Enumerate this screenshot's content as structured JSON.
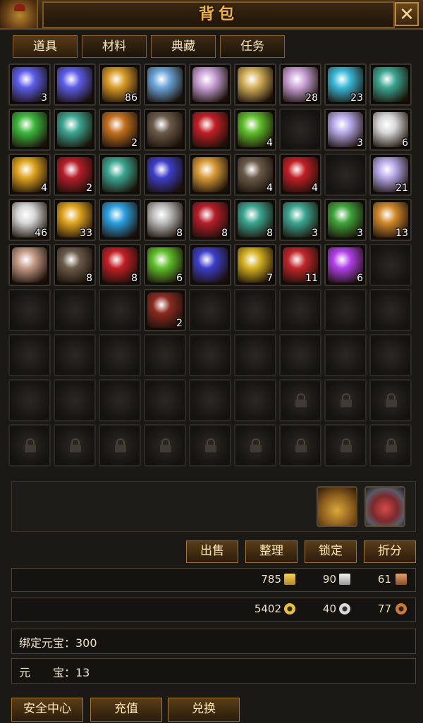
{
  "window": {
    "title": "背包",
    "close_label": "✕"
  },
  "tabs": [
    {
      "label": "道具"
    },
    {
      "label": "材料"
    },
    {
      "label": "典藏"
    },
    {
      "label": "任务"
    }
  ],
  "slots": [
    {
      "icon": "crystal-ball-icon",
      "qty": "3",
      "color": "#5b5ce8"
    },
    {
      "icon": "crystal-ball-icon",
      "qty": "",
      "color": "#5b5ce8"
    },
    {
      "icon": "gold-scroll-icon",
      "qty": "86",
      "color": "#d99b27"
    },
    {
      "icon": "blue-sand-icon",
      "qty": "",
      "color": "#6aa4d8"
    },
    {
      "icon": "rainbow-gem-icon",
      "qty": "",
      "color": "#c9a2d6"
    },
    {
      "icon": "rainbow-gem-icon",
      "qty": "",
      "color": "#d4b05a"
    },
    {
      "icon": "rainbow-gem-icon",
      "qty": "28",
      "color": "#c9a2d6"
    },
    {
      "icon": "cyan-orb-icon",
      "qty": "23",
      "color": "#38b8d6"
    },
    {
      "icon": "red-green-crystal-icon",
      "qty": "",
      "color": "#3aa58f"
    },
    {
      "icon": "diamond-ring-icon",
      "qty": "",
      "color": "#3cb83c"
    },
    {
      "icon": "red-green-crystal-icon",
      "qty": "",
      "color": "#3aa58f"
    },
    {
      "icon": "amber-egg-icon",
      "qty": "2",
      "color": "#c2701e"
    },
    {
      "icon": "obsidian-gem-icon",
      "qty": "",
      "color": "#6a5a4a"
    },
    {
      "icon": "ruby-icon",
      "qty": "",
      "color": "#c01f25"
    },
    {
      "icon": "peridot-icon",
      "qty": "4",
      "color": "#5fbf2a"
    },
    {
      "icon": "empty",
      "qty": "",
      "color": ""
    },
    {
      "icon": "moon-crystal-icon",
      "qty": "3",
      "color": "#b6a8e8"
    },
    {
      "icon": "diamond-icon",
      "qty": "6",
      "color": "#d6d6d6"
    },
    {
      "icon": "gold-ring-icon",
      "qty": "4",
      "color": "#e0a51e"
    },
    {
      "icon": "red-egg-icon",
      "qty": "2",
      "color": "#b51d2a"
    },
    {
      "icon": "red-green-crystal-icon",
      "qty": "",
      "color": "#3aa58f"
    },
    {
      "icon": "sapphire-rough-icon",
      "qty": "",
      "color": "#3c3ec8"
    },
    {
      "icon": "amber-egg-icon",
      "qty": "",
      "color": "#d89a38"
    },
    {
      "icon": "obsidian-gem-icon",
      "qty": "4",
      "color": "#6a5a4a"
    },
    {
      "icon": "ruby-icon",
      "qty": "4",
      "color": "#c01f25"
    },
    {
      "icon": "empty",
      "qty": "",
      "color": ""
    },
    {
      "icon": "moon-crystal-icon",
      "qty": "21",
      "color": "#b6a8e8"
    },
    {
      "icon": "diamond-icon",
      "qty": "46",
      "color": "#d6d6d6"
    },
    {
      "icon": "gold-ring-icon",
      "qty": "33",
      "color": "#e0a51e"
    },
    {
      "icon": "aquamarine-icon",
      "qty": "",
      "color": "#2aa0e0"
    },
    {
      "icon": "silver-gem-icon",
      "qty": "8",
      "color": "#bcbcbc"
    },
    {
      "icon": "red-egg-icon",
      "qty": "8",
      "color": "#b51d2a"
    },
    {
      "icon": "red-green-crystal-icon",
      "qty": "8",
      "color": "#3aa58f"
    },
    {
      "icon": "red-green-crystal-icon",
      "qty": "3",
      "color": "#3aa58f"
    },
    {
      "icon": "jade-ring-icon",
      "qty": "3",
      "color": "#3fa43a"
    },
    {
      "icon": "amber-egg-icon",
      "qty": "13",
      "color": "#d0882a"
    },
    {
      "icon": "hide-scroll-icon",
      "qty": "",
      "color": "#c49a86"
    },
    {
      "icon": "obsidian-gem-icon",
      "qty": "8",
      "color": "#6a5a4a"
    },
    {
      "icon": "ruby-icon",
      "qty": "8",
      "color": "#c01f25"
    },
    {
      "icon": "peridot-icon",
      "qty": "6",
      "color": "#5fbf2a"
    },
    {
      "icon": "sapphire-rough-icon",
      "qty": "",
      "color": "#3c3ec8"
    },
    {
      "icon": "citrine-icon",
      "qty": "7",
      "color": "#d4b020"
    },
    {
      "icon": "ruby-cluster-icon",
      "qty": "11",
      "color": "#c0262a"
    },
    {
      "icon": "violet-orb-icon",
      "qty": "6",
      "color": "#b040e8"
    },
    {
      "icon": "empty",
      "qty": "",
      "color": ""
    },
    {
      "icon": "empty",
      "qty": "",
      "color": ""
    },
    {
      "icon": "empty",
      "qty": "",
      "color": ""
    },
    {
      "icon": "empty",
      "qty": "",
      "color": ""
    },
    {
      "icon": "fish-icon",
      "qty": "2",
      "color": "#8a2b20"
    },
    {
      "icon": "empty",
      "qty": "",
      "color": ""
    },
    {
      "icon": "empty",
      "qty": "",
      "color": ""
    },
    {
      "icon": "empty",
      "qty": "",
      "color": ""
    },
    {
      "icon": "empty",
      "qty": "",
      "color": ""
    },
    {
      "icon": "empty",
      "qty": "",
      "color": ""
    },
    {
      "icon": "empty",
      "qty": "",
      "color": ""
    },
    {
      "icon": "empty",
      "qty": "",
      "color": ""
    },
    {
      "icon": "empty",
      "qty": "",
      "color": ""
    },
    {
      "icon": "empty",
      "qty": "",
      "color": ""
    },
    {
      "icon": "empty",
      "qty": "",
      "color": ""
    },
    {
      "icon": "empty",
      "qty": "",
      "color": ""
    },
    {
      "icon": "empty",
      "qty": "",
      "color": ""
    },
    {
      "icon": "empty",
      "qty": "",
      "color": ""
    },
    {
      "icon": "empty",
      "qty": "",
      "color": ""
    },
    {
      "icon": "empty",
      "qty": "",
      "color": ""
    },
    {
      "icon": "empty",
      "qty": "",
      "color": ""
    },
    {
      "icon": "empty",
      "qty": "",
      "color": ""
    },
    {
      "icon": "empty",
      "qty": "",
      "color": ""
    },
    {
      "icon": "empty",
      "qty": "",
      "color": ""
    },
    {
      "icon": "empty",
      "qty": "",
      "color": ""
    },
    {
      "icon": "lock-icon",
      "qty": "",
      "color": ""
    },
    {
      "icon": "lock-icon",
      "qty": "",
      "color": ""
    },
    {
      "icon": "lock-icon",
      "qty": "",
      "color": ""
    },
    {
      "icon": "lock-icon",
      "qty": "",
      "color": ""
    },
    {
      "icon": "lock-icon",
      "qty": "",
      "color": ""
    },
    {
      "icon": "lock-icon",
      "qty": "",
      "color": ""
    },
    {
      "icon": "lock-icon",
      "qty": "",
      "color": ""
    },
    {
      "icon": "lock-icon",
      "qty": "",
      "color": ""
    },
    {
      "icon": "lock-icon",
      "qty": "",
      "color": ""
    },
    {
      "icon": "lock-icon",
      "qty": "",
      "color": ""
    },
    {
      "icon": "lock-icon",
      "qty": "",
      "color": ""
    },
    {
      "icon": "lock-icon",
      "qty": "",
      "color": ""
    }
  ],
  "actions": {
    "sell": "出售",
    "sort": "整理",
    "lock": "锁定",
    "split": "折分"
  },
  "currency_row1": [
    {
      "value": "785",
      "icon": "gold-ingot-icon"
    },
    {
      "value": "90",
      "icon": "silver-book-icon"
    },
    {
      "value": "61",
      "icon": "bronze-book-icon"
    }
  ],
  "currency_row2": [
    {
      "value": "5402",
      "icon": "gold-coin-icon"
    },
    {
      "value": "40",
      "icon": "silver-coin-icon"
    },
    {
      "value": "77",
      "icon": "copper-coin-icon"
    }
  ],
  "bound_yuanbao": "绑定元宝：300",
  "yuanbao": "元　　宝：13",
  "bottom_buttons": {
    "security": "安全中心",
    "recharge": "充值",
    "exchange": "兑换"
  }
}
